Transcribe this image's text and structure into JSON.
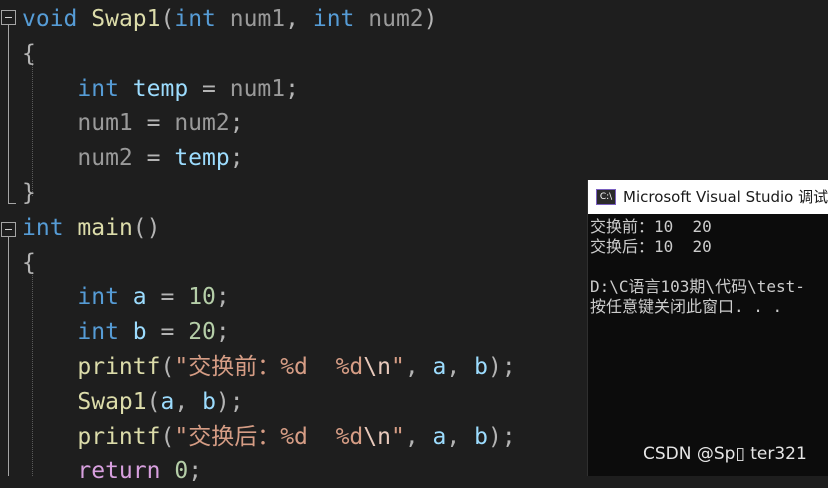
{
  "editor": {
    "lines": [
      {
        "tokens": [
          {
            "t": "void",
            "c": "kw"
          },
          {
            "t": " "
          },
          {
            "t": "Swap1",
            "c": "fn"
          },
          {
            "t": "(",
            "c": "punc"
          },
          {
            "t": "int",
            "c": "kw"
          },
          {
            "t": " "
          },
          {
            "t": "num1",
            "c": "param"
          },
          {
            "t": ", ",
            "c": "punc"
          },
          {
            "t": "int",
            "c": "kw"
          },
          {
            "t": " "
          },
          {
            "t": "num2",
            "c": "param"
          },
          {
            "t": ")",
            "c": "punc"
          }
        ]
      },
      {
        "tokens": [
          {
            "t": "{",
            "c": "punc"
          }
        ]
      },
      {
        "tokens": [
          {
            "t": "    "
          },
          {
            "t": "int",
            "c": "kw"
          },
          {
            "t": " "
          },
          {
            "t": "temp",
            "c": "var"
          },
          {
            "t": " = ",
            "c": "punc"
          },
          {
            "t": "num1",
            "c": "param"
          },
          {
            "t": ";",
            "c": "punc"
          }
        ]
      },
      {
        "tokens": [
          {
            "t": "    "
          },
          {
            "t": "num1",
            "c": "param"
          },
          {
            "t": " = ",
            "c": "punc"
          },
          {
            "t": "num2",
            "c": "param"
          },
          {
            "t": ";",
            "c": "punc"
          }
        ]
      },
      {
        "tokens": [
          {
            "t": "    "
          },
          {
            "t": "num2",
            "c": "param"
          },
          {
            "t": " = ",
            "c": "punc"
          },
          {
            "t": "temp",
            "c": "var"
          },
          {
            "t": ";",
            "c": "punc"
          }
        ]
      },
      {
        "tokens": [
          {
            "t": "}",
            "c": "punc"
          }
        ]
      },
      {
        "tokens": [
          {
            "t": "int",
            "c": "kw"
          },
          {
            "t": " "
          },
          {
            "t": "main",
            "c": "fn"
          },
          {
            "t": "()",
            "c": "punc"
          }
        ]
      },
      {
        "tokens": [
          {
            "t": "{",
            "c": "punc"
          }
        ]
      },
      {
        "tokens": [
          {
            "t": "    "
          },
          {
            "t": "int",
            "c": "kw"
          },
          {
            "t": " "
          },
          {
            "t": "a",
            "c": "var"
          },
          {
            "t": " = ",
            "c": "punc"
          },
          {
            "t": "10",
            "c": "num"
          },
          {
            "t": ";",
            "c": "punc"
          }
        ]
      },
      {
        "tokens": [
          {
            "t": "    "
          },
          {
            "t": "int",
            "c": "kw"
          },
          {
            "t": " "
          },
          {
            "t": "b",
            "c": "var"
          },
          {
            "t": " = ",
            "c": "punc"
          },
          {
            "t": "20",
            "c": "num"
          },
          {
            "t": ";",
            "c": "punc"
          }
        ]
      },
      {
        "tokens": [
          {
            "t": "    "
          },
          {
            "t": "printf",
            "c": "fn"
          },
          {
            "t": "(",
            "c": "punc"
          },
          {
            "t": "\"交换前：%d  %d",
            "c": "str"
          },
          {
            "t": "\\n",
            "c": "esc"
          },
          {
            "t": "\"",
            "c": "str"
          },
          {
            "t": ", ",
            "c": "punc"
          },
          {
            "t": "a",
            "c": "var"
          },
          {
            "t": ", ",
            "c": "punc"
          },
          {
            "t": "b",
            "c": "var"
          },
          {
            "t": ");",
            "c": "punc"
          }
        ]
      },
      {
        "tokens": [
          {
            "t": "    "
          },
          {
            "t": "Swap1",
            "c": "fn"
          },
          {
            "t": "(",
            "c": "punc"
          },
          {
            "t": "a",
            "c": "var"
          },
          {
            "t": ", ",
            "c": "punc"
          },
          {
            "t": "b",
            "c": "var"
          },
          {
            "t": ");",
            "c": "punc"
          }
        ]
      },
      {
        "tokens": [
          {
            "t": "    "
          },
          {
            "t": "printf",
            "c": "fn"
          },
          {
            "t": "(",
            "c": "punc"
          },
          {
            "t": "\"交换后：%d  %d",
            "c": "str"
          },
          {
            "t": "\\n",
            "c": "esc"
          },
          {
            "t": "\"",
            "c": "str"
          },
          {
            "t": ", ",
            "c": "punc"
          },
          {
            "t": "a",
            "c": "var"
          },
          {
            "t": ", ",
            "c": "punc"
          },
          {
            "t": "b",
            "c": "var"
          },
          {
            "t": ");",
            "c": "punc"
          }
        ]
      },
      {
        "tokens": [
          {
            "t": "    "
          },
          {
            "t": "return",
            "c": "ctl"
          },
          {
            "t": " "
          },
          {
            "t": "0",
            "c": "num"
          },
          {
            "t": ";",
            "c": "punc"
          }
        ]
      }
    ]
  },
  "console": {
    "icon_label": "C:\\",
    "title": "Microsoft Visual Studio 调试控制台",
    "lines": [
      "交换前：10  20",
      "交换后：10  20",
      "",
      "D:\\C语言103期\\代码\\test-",
      "按任意键关闭此窗口. . ."
    ]
  },
  "watermark": "CSDN @Sp▯ ter321"
}
